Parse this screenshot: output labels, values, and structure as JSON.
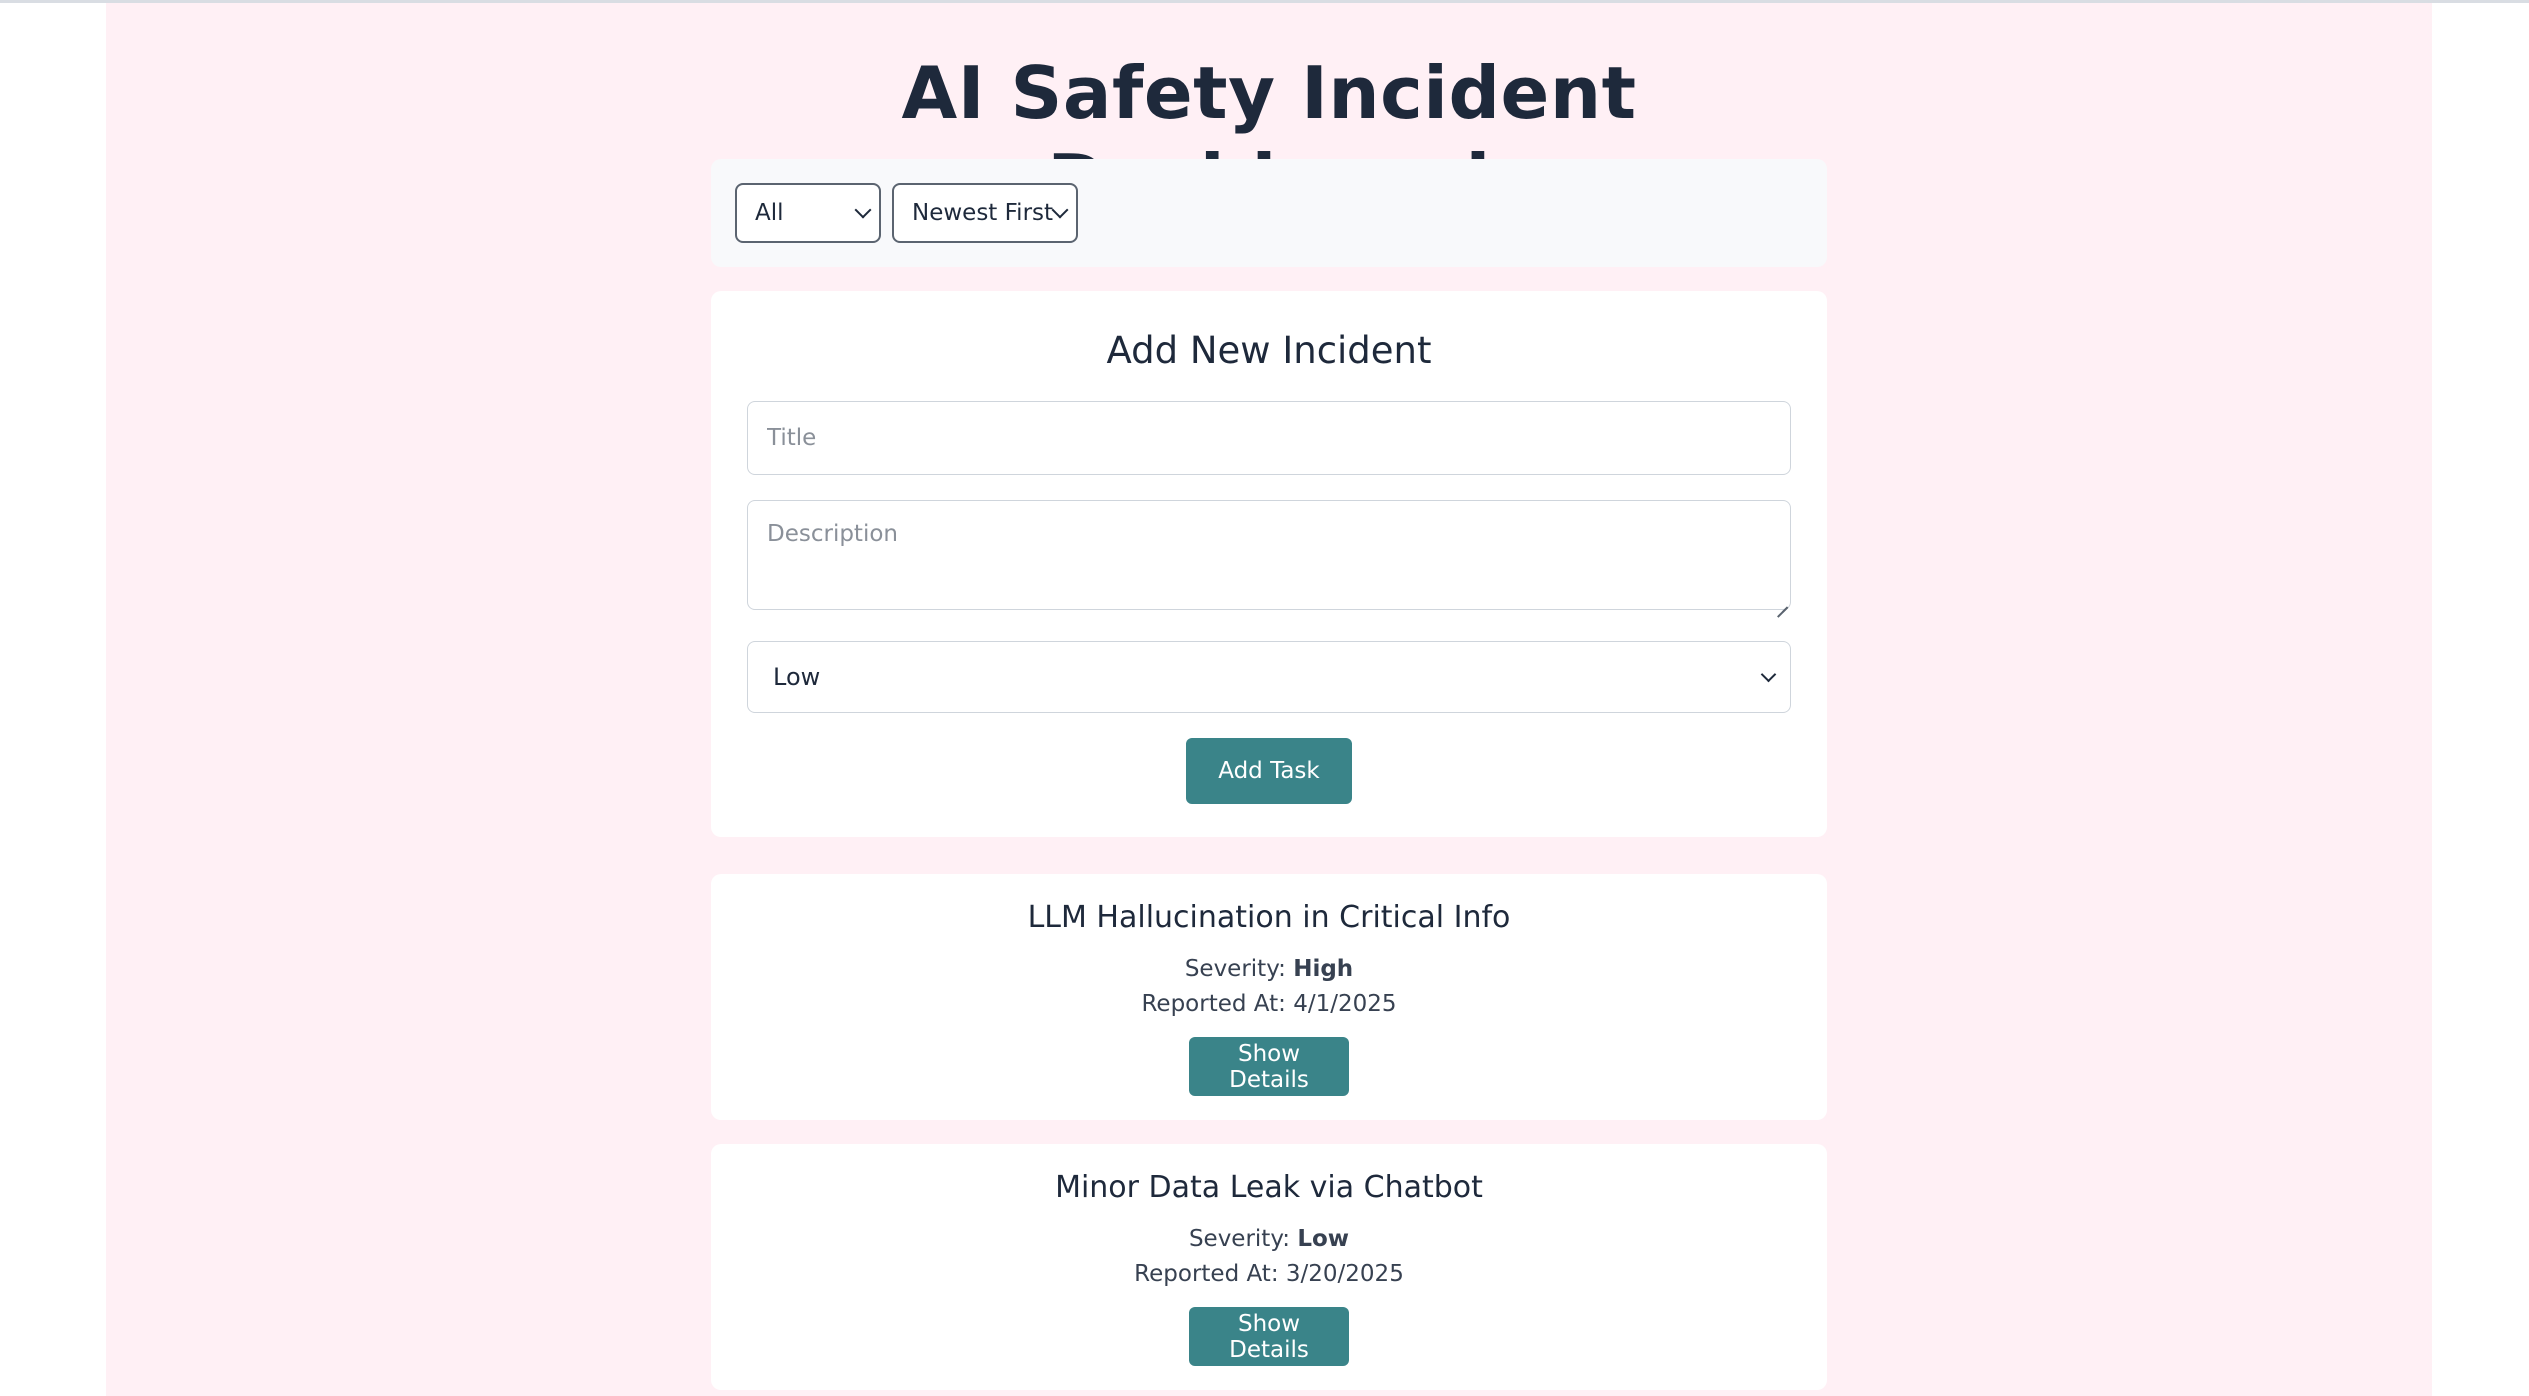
{
  "header": {
    "title": "AI Safety Incident Dashboard"
  },
  "filters": {
    "severity_filter_value": "All",
    "sort_value": "Newest First"
  },
  "form": {
    "heading": "Add New Incident",
    "title_placeholder": "Title",
    "description_placeholder": "Description",
    "severity_value": "Low",
    "submit_label": "Add Task"
  },
  "incidents": [
    {
      "title": "LLM Hallucination in Critical Info",
      "severity_label": "Severity:",
      "severity": "High",
      "reported_label": "Reported At:",
      "reported_at": "4/1/2025",
      "button_label": "Show Details"
    },
    {
      "title": "Minor Data Leak via Chatbot",
      "severity_label": "Severity:",
      "severity": "Low",
      "reported_label": "Reported At:",
      "reported_at": "3/20/2025",
      "button_label": "Show Details"
    }
  ],
  "colors": {
    "page_background": "#fff0f5",
    "accent": "#3a8489",
    "text": "#1e293b"
  },
  "icons": {
    "dropdown": "chevron-down-icon",
    "textarea_resize": "resize-grip-icon"
  }
}
